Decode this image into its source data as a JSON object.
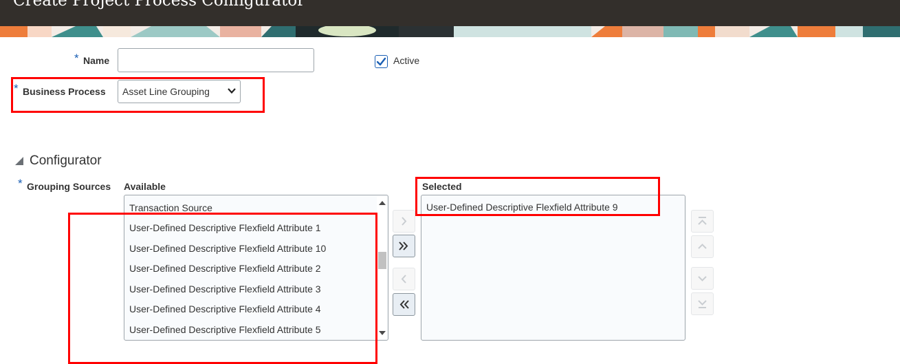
{
  "header": {
    "title": "Create Project Process Configurator"
  },
  "form": {
    "name": {
      "label": "Name",
      "required_mark": "*",
      "value": ""
    },
    "active": {
      "label": "Active",
      "checked": true
    },
    "business_process": {
      "label": "Business Process",
      "required_mark": "*",
      "selected": "Asset Line Grouping"
    }
  },
  "configurator": {
    "section_title": "Configurator",
    "grouping_sources": {
      "label": "Grouping Sources",
      "required_mark": "*"
    },
    "available": {
      "header": "Available",
      "items": [
        "Transaction Source",
        "User-Defined Descriptive Flexfield Attribute 1",
        "User-Defined Descriptive Flexfield Attribute 10",
        "User-Defined Descriptive Flexfield Attribute 2",
        "User-Defined Descriptive Flexfield Attribute 3",
        "User-Defined Descriptive Flexfield Attribute 4",
        "User-Defined Descriptive Flexfield Attribute 5"
      ]
    },
    "selected": {
      "header": "Selected",
      "items": [
        "User-Defined Descriptive Flexfield Attribute 9"
      ]
    }
  },
  "colors": {
    "header_bg": "#332f2b",
    "highlight": "#ff0000",
    "required": "#1a5fb4",
    "checkbox": "#1a5fb4"
  }
}
